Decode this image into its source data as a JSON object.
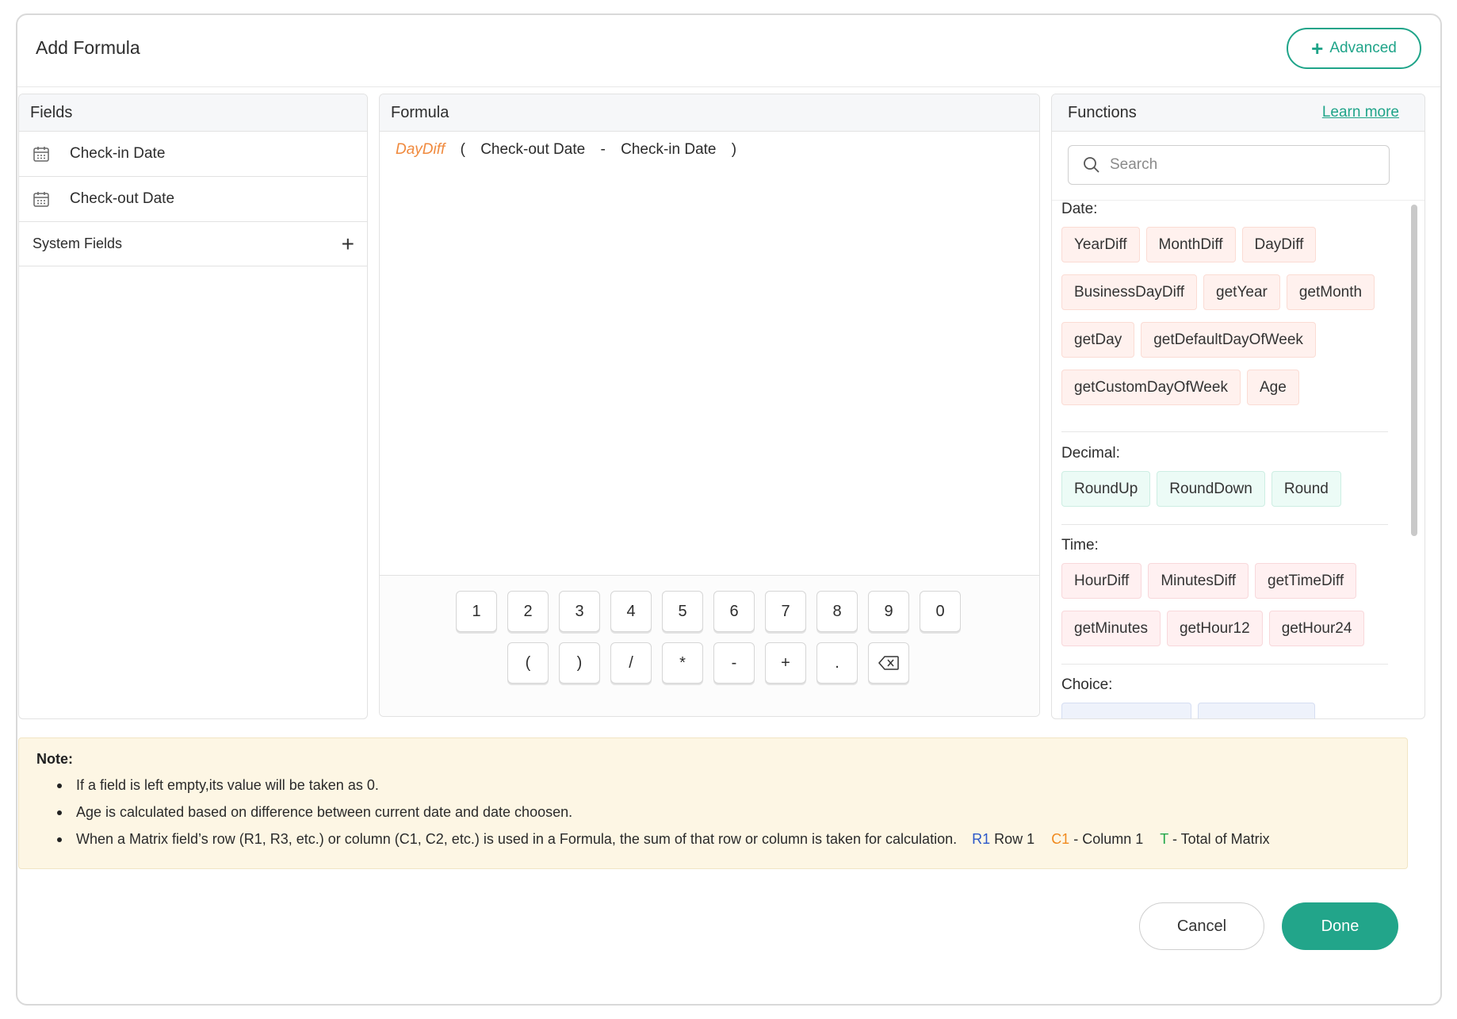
{
  "dialog": {
    "title": "Add Formula",
    "advanced_label": "Advanced"
  },
  "fields": {
    "header": "Fields",
    "items": [
      {
        "label": "Check-in Date",
        "icon": "calendar-icon"
      },
      {
        "label": "Check-out Date",
        "icon": "calendar-icon"
      }
    ],
    "system_fields_label": "System Fields"
  },
  "formula": {
    "header": "Formula",
    "tokens": [
      "DayDiff",
      "(",
      "Check-out Date",
      "-",
      "Check-in Date",
      ")"
    ],
    "keypad_row1": [
      "1",
      "2",
      "3",
      "4",
      "5",
      "6",
      "7",
      "8",
      "9",
      "0"
    ],
    "keypad_row2": [
      "(",
      ")",
      "/",
      "*",
      "-",
      "+",
      "."
    ],
    "backspace_icon": "backspace-icon"
  },
  "functions": {
    "header": "Functions",
    "learn_more": "Learn more",
    "search_placeholder": "Search",
    "categories": [
      {
        "title": "Date:",
        "kind": "date",
        "items": [
          "YearDiff",
          "MonthDiff",
          "DayDiff",
          "BusinessDayDiff",
          "getYear",
          "getMonth",
          "getDay",
          "getDefaultDayOfWeek",
          "getCustomDayOfWeek",
          "Age"
        ]
      },
      {
        "title": "Decimal:",
        "kind": "decimal",
        "items": [
          "RoundUp",
          "RoundDown",
          "Round"
        ]
      },
      {
        "title": "Time:",
        "kind": "time",
        "items": [
          "HourDiff",
          "MinutesDiff",
          "getTimeDiff",
          "getMinutes",
          "getHour12",
          "getHour24"
        ]
      },
      {
        "title": "Choice:",
        "kind": "choice",
        "items": []
      }
    ]
  },
  "note": {
    "title": "Note:",
    "items": [
      "If a field is left empty,its value will be taken as 0.",
      "Age is calculated based on difference between current date and date choosen.",
      "When a Matrix field’s row (R1, R3, etc.) or column (C1, C2, etc.) is used in a Formula, the sum of that row or column is taken for calculation."
    ],
    "legend": {
      "r_code": "R1",
      "r_text": "Row 1",
      "c_code": "C1",
      "c_text": "- Column 1",
      "t_code": "T",
      "t_text": "- Total of Matrix"
    }
  },
  "footer": {
    "cancel_label": "Cancel",
    "done_label": "Done"
  },
  "colors": {
    "accent": "#1fa489",
    "done_bg": "#22a58a",
    "function_token": "#f08a3e",
    "note_bg": "#fdf6e4"
  }
}
